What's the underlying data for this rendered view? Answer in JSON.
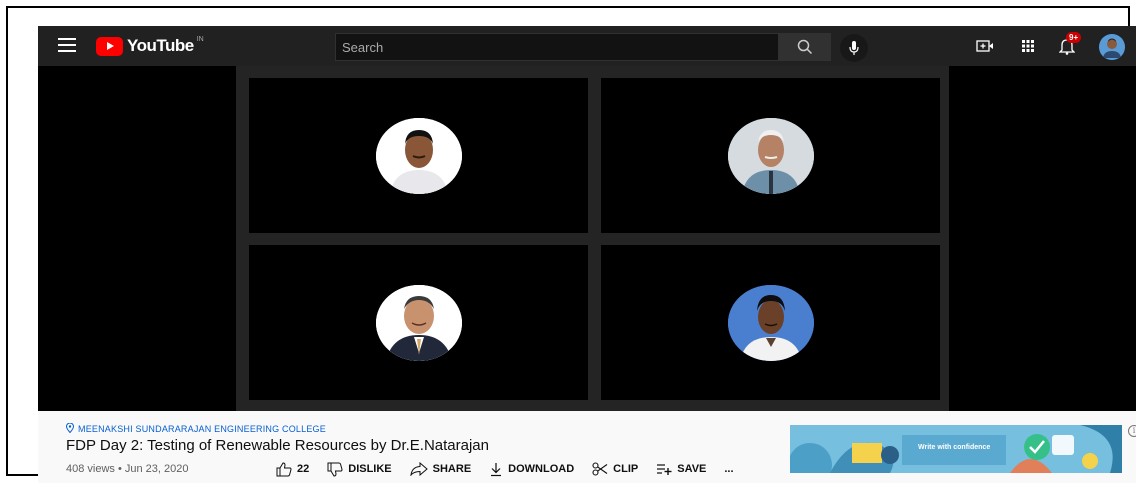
{
  "header": {
    "logo_text": "YouTube",
    "region": "IN",
    "search_placeholder": "Search",
    "notification_count": "9+"
  },
  "video": {
    "participants": [
      {
        "name": "participant-1",
        "bg": "#ffffff"
      },
      {
        "name": "participant-2",
        "bg": "#cfd5da"
      },
      {
        "name": "participant-3",
        "bg": "#ffffff"
      },
      {
        "name": "participant-4",
        "bg": "#3b6fc2"
      }
    ]
  },
  "info": {
    "channel_location": "MEENAKSHI SUNDARARAJAN ENGINEERING COLLEGE",
    "title": "FDP Day 2: Testing of Renewable Resources by Dr.E.Natarajan",
    "meta": "408 views • Jun 23, 2020",
    "actions": {
      "like_count": "22",
      "dislike": "DISLIKE",
      "share": "SHARE",
      "download": "DOWNLOAD",
      "clip": "CLIP",
      "save": "SAVE",
      "more": "..."
    },
    "ad_text": "Write with confidence",
    "ad_info": "i"
  },
  "colors": {
    "topbar": "#212121",
    "brand_red": "#ff0000",
    "link_blue": "#065fd4"
  }
}
